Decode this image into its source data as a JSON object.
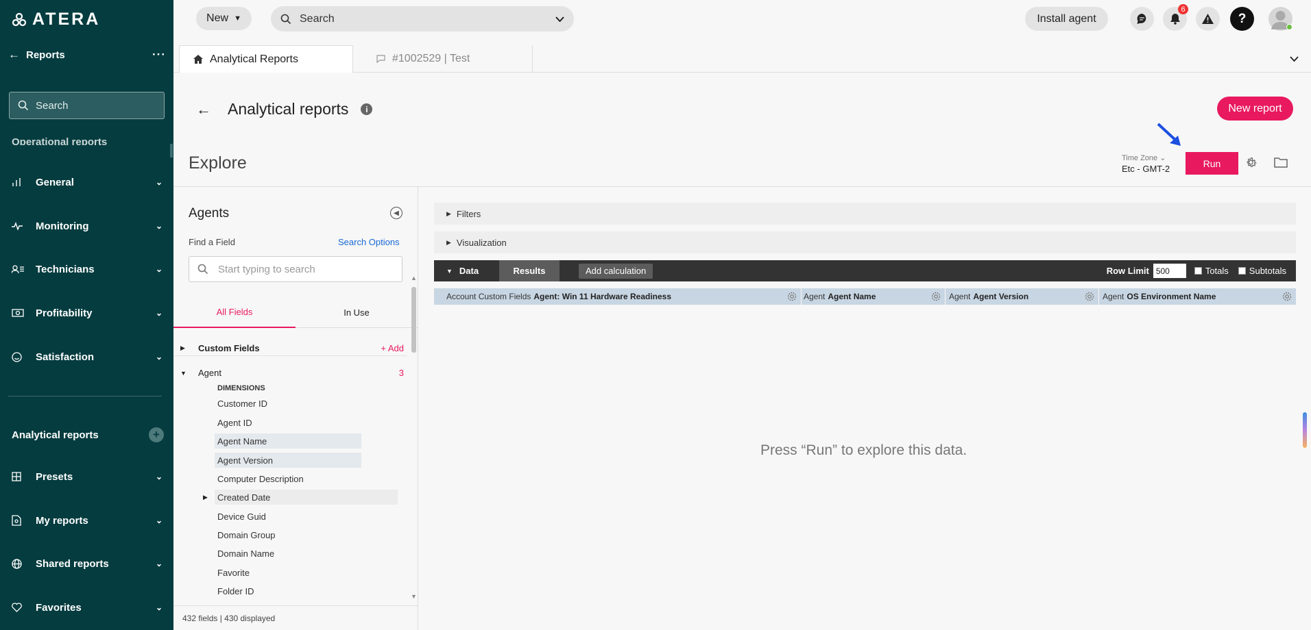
{
  "brand": {
    "name": "ATERA"
  },
  "sidebar": {
    "header": "Reports",
    "search_placeholder": "Search",
    "cut_label": "Operational reports",
    "items": [
      {
        "label": "General",
        "icon": "bar-chart-icon"
      },
      {
        "label": "Monitoring",
        "icon": "pulse-icon"
      },
      {
        "label": "Technicians",
        "icon": "technicians-icon"
      },
      {
        "label": "Profitability",
        "icon": "money-icon"
      },
      {
        "label": "Satisfaction",
        "icon": "smiley-icon"
      }
    ],
    "analytical_label": "Analytical reports",
    "analytical_items": [
      {
        "label": "Presets",
        "icon": "grid-icon"
      },
      {
        "label": "My reports",
        "icon": "my-reports-icon"
      },
      {
        "label": "Shared reports",
        "icon": "globe-icon"
      },
      {
        "label": "Favorites",
        "icon": "heart-icon"
      }
    ]
  },
  "topbar": {
    "new_label": "New",
    "search_placeholder": "Search",
    "install_label": "Install agent",
    "notification_count": "6"
  },
  "tabs": [
    {
      "label": "Analytical Reports",
      "active": true
    },
    {
      "label": "#1002529 | Test",
      "active": false
    }
  ],
  "page": {
    "title": "Analytical reports",
    "new_report_label": "New report",
    "explore_label": "Explore",
    "timezone_label": "Time Zone",
    "timezone_value": "Etc - GMT-2",
    "run_label": "Run"
  },
  "field_panel": {
    "title": "Agents",
    "find_label": "Find a Field",
    "search_options_label": "Search Options",
    "search_placeholder": "Start typing to search",
    "tab_all": "All Fields",
    "tab_in_use": "In Use",
    "custom_fields_label": "Custom Fields",
    "add_label": "+ Add",
    "agent_label": "Agent",
    "agent_count": "3",
    "dimensions_label": "DIMENSIONS",
    "fields": [
      "Customer ID",
      "Agent ID",
      "Agent Name",
      "Agent Version",
      "Computer Description",
      "Created Date",
      "Device Guid",
      "Domain Group",
      "Domain Name",
      "Favorite",
      "Folder ID"
    ],
    "footer": "432 fields | 430 displayed"
  },
  "explore": {
    "filters_label": "Filters",
    "visualization_label": "Visualization",
    "data_label": "Data",
    "results_label": "Results",
    "add_calc_label": "Add calculation",
    "row_limit_label": "Row Limit",
    "row_limit_value": "500",
    "totals_label": "Totals",
    "subtotals_label": "Subtotals",
    "columns": [
      {
        "prefix": "Account Custom Fields",
        "name": "Agent: Win 11 Hardware Readiness"
      },
      {
        "prefix": "Agent",
        "name": "Agent Name"
      },
      {
        "prefix": "Agent",
        "name": "Agent Version"
      },
      {
        "prefix": "Agent",
        "name": "OS Environment Name"
      }
    ],
    "empty_message": "Press “Run” to explore this data."
  }
}
